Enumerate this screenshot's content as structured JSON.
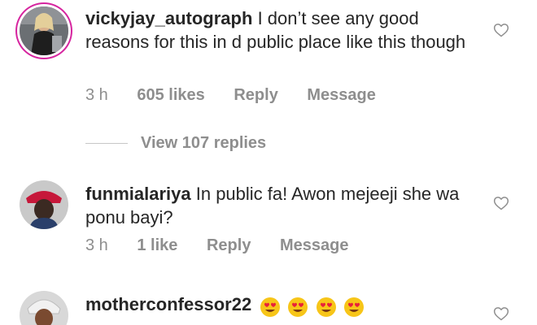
{
  "comments": [
    {
      "username": "vickyjay_autograph",
      "text": "I don’t see any good reasons for this in d public place like this though",
      "time": "3 h",
      "likes": "605 likes",
      "reply": "Reply",
      "message": "Message"
    },
    {
      "username": "funmialariya",
      "text": "In public fa! Awon mejeeji she wa ponu bayi?",
      "time": "3 h",
      "likes": "1 like",
      "reply": "Reply",
      "message": "Message"
    },
    {
      "username": "motherconfessor22",
      "text": ""
    }
  ],
  "view_replies": "View 107 replies",
  "colors": {
    "text": "#262626",
    "muted": "#8e8e8e",
    "story_ring": "#d6249f",
    "emoji_face": "#f7c518",
    "emoji_heart": "#e8213a"
  },
  "icons": {
    "like": "heart-outline-icon",
    "emoji": "heart-eyes-emoji"
  }
}
